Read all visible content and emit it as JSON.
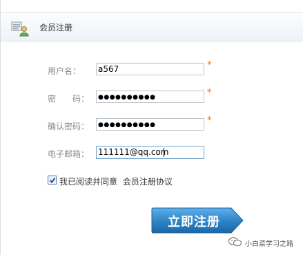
{
  "header": {
    "title": "会员注册",
    "icon": "member-card-icon"
  },
  "form": {
    "username": {
      "label": "用户名：",
      "value": "a567",
      "required_mark": "*"
    },
    "password": {
      "label": "密　　码：",
      "masked_value": "●●●●●●●●●●",
      "required_mark": "*"
    },
    "confirm_password": {
      "label": "确认密码：",
      "masked_value": "●●●●●●●●●●",
      "required_mark": "*"
    },
    "email": {
      "label": "电子邮箱：",
      "value": "111111@qq.com"
    }
  },
  "agreement": {
    "checked": true,
    "text": "我已阅读并同意",
    "link_text": "会员注册协议"
  },
  "submit": {
    "label": "立即注册"
  },
  "watermark": {
    "text": "小白菜学习之路",
    "icon": "wechat-icon"
  },
  "colors": {
    "accent": "#2f86c9",
    "required": "#ff6a00",
    "label": "#8a8a8a"
  }
}
